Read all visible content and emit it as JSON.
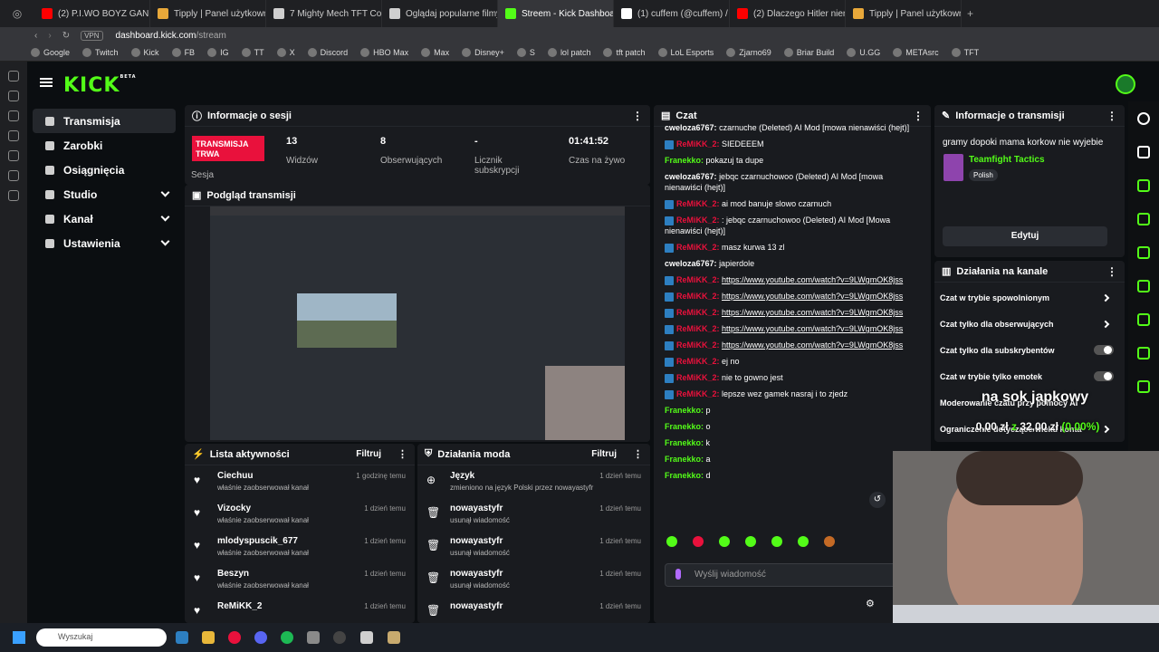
{
  "browser": {
    "tabs": [
      {
        "label": "(2) P.I.WO BOYZ GAN",
        "color": "#ff0000"
      },
      {
        "label": "Tipply | Panel użytkownik",
        "color": "#e8a83a"
      },
      {
        "label": "7 Mighty Mech TFT Com",
        "color": "#cfcfcf"
      },
      {
        "label": "Oglądaj popularne filmy",
        "color": "#cfcfcf"
      },
      {
        "label": "Streem - Kick Dashboard",
        "color": "#53fc18"
      },
      {
        "label": "(1) cuffem (@cuffem) / X",
        "color": "#ffffff"
      },
      {
        "label": "(2) Dlaczego Hitler nienaw",
        "color": "#ff0000"
      },
      {
        "label": "Tipply | Panel użytkownik",
        "color": "#e8a83a"
      }
    ],
    "vpn": "VPN",
    "url_domain": "dashboard.kick.com",
    "url_path": "/stream",
    "bookmarks": [
      "Google",
      "Twitch",
      "Kick",
      "FB",
      "IG",
      "TT",
      "X",
      "Discord",
      "HBO Max",
      "Max",
      "Disney+",
      "S",
      "lol patch",
      "tft patch",
      "LoL Esports",
      "Zjarno69",
      "Briar Build",
      "U.GG",
      "METAsrc",
      "TFT"
    ]
  },
  "kick": {
    "logo": "KICK",
    "logo_badge": "BETA"
  },
  "sidenav": [
    {
      "label": "Transmisja",
      "active": true,
      "chevron": false
    },
    {
      "label": "Zarobki",
      "active": false,
      "chevron": false
    },
    {
      "label": "Osiągnięcia",
      "active": false,
      "chevron": false
    },
    {
      "label": "Studio",
      "active": false,
      "chevron": true
    },
    {
      "label": "Kanał",
      "active": false,
      "chevron": true
    },
    {
      "label": "Ustawienia",
      "active": false,
      "chevron": true
    }
  ],
  "session": {
    "title": "Informacje o sesji",
    "live_badge": "TRANSMISJA TRWA",
    "session_label": "Sesja",
    "viewers_value": "13",
    "viewers_label": "Widzów",
    "followers_value": "8",
    "followers_label": "Obserwujących",
    "subs_value": "-",
    "subs_label": "Licznik subskrypcji",
    "time_value": "01:41:52",
    "time_label": "Czas na żywo"
  },
  "preview": {
    "title": "Podgląd transmisji"
  },
  "activity": {
    "title": "Lista aktywności",
    "filter": "Filtruj",
    "items": [
      {
        "name": "Ciechuu",
        "sub": "właśnie zaobserwował kanał",
        "time": "1 godzinę temu"
      },
      {
        "name": "Vizocky",
        "sub": "właśnie zaobserwował kanał",
        "time": "1 dzień temu"
      },
      {
        "name": "mlodyspuscik_677",
        "sub": "właśnie zaobserwował kanał",
        "time": "1 dzień temu"
      },
      {
        "name": "Beszyn",
        "sub": "właśnie zaobserwował kanał",
        "time": "1 dzień temu"
      },
      {
        "name": "ReMiKK_2",
        "sub": "",
        "time": "1 dzień temu"
      }
    ]
  },
  "modactions": {
    "title": "Działania moda",
    "filter": "Filtruj",
    "items": [
      {
        "name": "Język",
        "sub": "zmieniono na język Polski przez nowayastyfr",
        "time": "1 dzień temu",
        "icon": "globe"
      },
      {
        "name": "nowayastyfr",
        "sub": "usunął wiadomość",
        "time": "1 dzień temu",
        "icon": "trash"
      },
      {
        "name": "nowayastyfr",
        "sub": "usunął wiadomość",
        "time": "1 dzień temu",
        "icon": "trash"
      },
      {
        "name": "nowayastyfr",
        "sub": "usunął wiadomość",
        "time": "1 dzień temu",
        "icon": "trash"
      },
      {
        "name": "nowayastyfr",
        "sub": "",
        "time": "1 dzień temu",
        "icon": "trash"
      }
    ]
  },
  "chat": {
    "title": "Czat",
    "input_placeholder": "Wyślij wiadomość",
    "messages": [
      {
        "user": "cweloza6767:",
        "color": "#ffffff",
        "badge": false,
        "text": "czarnuche (Deleted) AI Mod [mowa nienawiści (hejt)]"
      },
      {
        "user": "ReMiKK_2:",
        "color": "#e9113c",
        "badge": true,
        "text": "SIEDEEEM"
      },
      {
        "user": "Franekko:",
        "color": "#53fc18",
        "badge": false,
        "text": "pokazuj ta dupe"
      },
      {
        "user": "cweloza6767:",
        "color": "#ffffff",
        "badge": false,
        "text": "jebqc czarnuchowoo (Deleted) AI Mod [mowa nienawiści (hejt)]"
      },
      {
        "user": "ReMiKK_2:",
        "color": "#e9113c",
        "badge": true,
        "text": "ai mod banuje slowo czarnuch"
      },
      {
        "user": "ReMiKK_2:",
        "color": "#e9113c",
        "badge": true,
        "text": ": jebqc czarnuchowoo (Deleted) AI Mod [Mowa nienawiści (hejt)]"
      },
      {
        "user": "ReMiKK_2:",
        "color": "#e9113c",
        "badge": true,
        "text": "masz kurwa 13 zl"
      },
      {
        "user": "cweloza6767:",
        "color": "#ffffff",
        "badge": false,
        "text": "japierdole"
      },
      {
        "user": "ReMiKK_2:",
        "color": "#e9113c",
        "badge": true,
        "text": "https://www.youtube.com/watch?v=9LWgmOK8jss",
        "link": true
      },
      {
        "user": "ReMiKK_2:",
        "color": "#e9113c",
        "badge": true,
        "text": "https://www.youtube.com/watch?v=9LWgmOK8jss",
        "link": true
      },
      {
        "user": "ReMiKK_2:",
        "color": "#e9113c",
        "badge": true,
        "text": "https://www.youtube.com/watch?v=9LWgmOK8jss",
        "link": true
      },
      {
        "user": "ReMiKK_2:",
        "color": "#e9113c",
        "badge": true,
        "text": "https://www.youtube.com/watch?v=9LWgmOK8jss",
        "link": true
      },
      {
        "user": "ReMiKK_2:",
        "color": "#e9113c",
        "badge": true,
        "text": "https://www.youtube.com/watch?v=9LWgmOK8jss",
        "link": true
      },
      {
        "user": "ReMiKK_2:",
        "color": "#e9113c",
        "badge": true,
        "text": "ej no"
      },
      {
        "user": "ReMiKK_2:",
        "color": "#e9113c",
        "badge": true,
        "text": "nie to gowno jest"
      },
      {
        "user": "ReMiKK_2:",
        "color": "#e9113c",
        "badge": true,
        "text": "lepsze wez gamek nasraj i to zjedz"
      },
      {
        "user": "Franekko:",
        "color": "#53fc18",
        "badge": false,
        "text": "p"
      },
      {
        "user": "Franekko:",
        "color": "#53fc18",
        "badge": false,
        "text": "o"
      },
      {
        "user": "Franekko:",
        "color": "#53fc18",
        "badge": false,
        "text": "k"
      },
      {
        "user": "Franekko:",
        "color": "#53fc18",
        "badge": false,
        "text": "a"
      },
      {
        "user": "Franekko:",
        "color": "#53fc18",
        "badge": false,
        "text": "d"
      }
    ]
  },
  "stream_info": {
    "title": "Informacje o transmisji",
    "stream_title": "gramy dopoki mama korkow nie wyjebie",
    "category": "Teamfight Tactics",
    "language": "Polish",
    "edit_button": "Edytuj"
  },
  "channel_actions": {
    "title": "Działania na kanale",
    "items": [
      {
        "label": "Czat w trybie spowolnionym",
        "type": "arrow"
      },
      {
        "label": "Czat tylko dla obserwujących",
        "type": "arrow"
      },
      {
        "label": "Czat tylko dla subskrybentów",
        "type": "toggle"
      },
      {
        "label": "Czat w trybie tylko emotek",
        "type": "toggle"
      },
      {
        "label": "Moderowanie czatu przy pomocy AI",
        "type": "none"
      },
      {
        "label": "Ograniczenie dotyczące wieku konta",
        "type": "arrow"
      }
    ]
  },
  "overlay": {
    "goal_title": "na sok japkowy",
    "goal_current": "0,00 zł",
    "goal_sep": "z",
    "goal_target": "32,00 zł",
    "goal_percent": "(0.00%)"
  },
  "taskbar": {
    "search_placeholder": "Wyszukaj"
  }
}
